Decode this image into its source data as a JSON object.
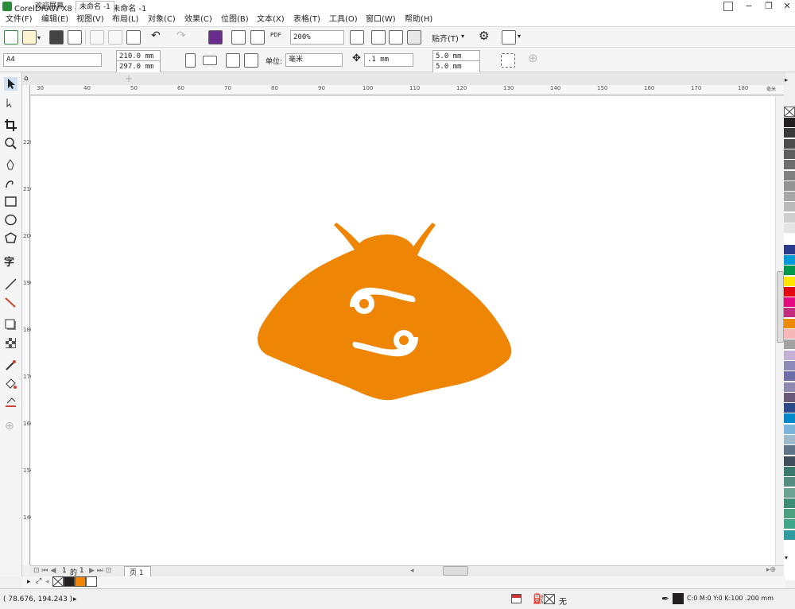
{
  "window": {
    "title": "CorelDRAW X8 (64-Bit) - 未命名 -1",
    "controls": [
      "−",
      "❐",
      "✕"
    ],
    "extra_icon": "person-icon"
  },
  "menu": [
    "文件(F)",
    "编辑(E)",
    "视图(V)",
    "布局(L)",
    "对象(C)",
    "效果(C)",
    "位图(B)",
    "文本(X)",
    "表格(T)",
    "工具(O)",
    "窗口(W)",
    "帮助(H)"
  ],
  "toolbar": {
    "zoom": "200%",
    "snap_label": "贴齐(T)",
    "pdf_label": "PDF"
  },
  "property_bar": {
    "page_size": "A4",
    "width": "210.0 mm",
    "height": "297.0 mm",
    "unit_label": "单位:",
    "unit": "毫米",
    "nudge": ".1 mm",
    "dup_x": "5.0 mm",
    "dup_y": "5.0 mm"
  },
  "tabs": [
    {
      "label": "欢迎屏幕",
      "icon": "home-icon"
    },
    {
      "label": "未命名 -1"
    }
  ],
  "rulers": {
    "h_ticks": [
      "30",
      "40",
      "50",
      "60",
      "70",
      "80",
      "90",
      "100",
      "110",
      "120",
      "130",
      "140",
      "150",
      "160",
      "170",
      "180"
    ],
    "v_ticks": [
      "220",
      "210",
      "200",
      "190",
      "180",
      "170",
      "160",
      "150",
      "140"
    ],
    "h_unit": "毫米"
  },
  "page_nav": {
    "current": "1",
    "sep": "的",
    "total": "1",
    "page_tab": "页 1"
  },
  "status": {
    "coords": "( 78.676, 194.243 )",
    "fill_label": "无",
    "outline": "C:0 M:0 Y:0 K:100  .200 mm"
  },
  "artwork": {
    "fill_color": "#ee8505",
    "symbol": "cancer-zodiac",
    "type": "money-bag"
  },
  "palette_colors": [
    "#231f20",
    "#3a3a3a",
    "#4d4d4d",
    "#5e5e5e",
    "#6e6e6e",
    "#808080",
    "#939393",
    "#a6a6a6",
    "#bababa",
    "#cfcfcf",
    "#e4e4e4",
    "#ffffff",
    "#2a3a8c",
    "#0099d8",
    "#00964b",
    "#ffe600",
    "#e30613",
    "#e5097f",
    "#c42c7f",
    "#f08a00",
    "#f7b7b8",
    "#a2a2a2",
    "#c5b0d5",
    "#8d8ab8",
    "#6d6ea8",
    "#8f88b0",
    "#6a5a7a",
    "#2a4a8c",
    "#0088c8",
    "#7ab6dc",
    "#9db9cc",
    "#5f7488",
    "#404e5c",
    "#3d7a6e",
    "#578d80",
    "#6ba291",
    "#3d8c74",
    "#4aa080",
    "#40a68a",
    "#2f9aa0"
  ],
  "doc_palette": [
    "none",
    "#231f20",
    "#ee8505",
    "#ffffff"
  ]
}
